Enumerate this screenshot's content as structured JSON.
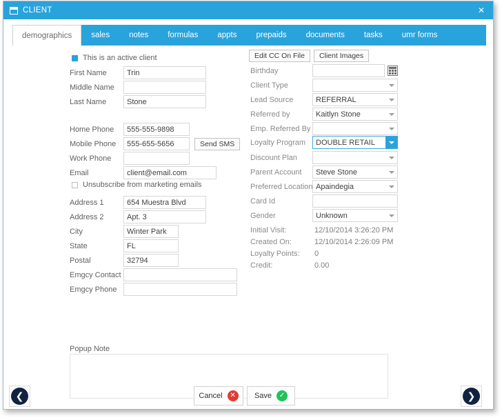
{
  "window": {
    "title": "CLIENT",
    "title_icon": "window-icon",
    "close_label": "✕"
  },
  "tabs": [
    {
      "label": "demographics",
      "active": true
    },
    {
      "label": "sales",
      "active": false
    },
    {
      "label": "notes",
      "active": false
    },
    {
      "label": "formulas",
      "active": false
    },
    {
      "label": "appts",
      "active": false
    },
    {
      "label": "prepaids",
      "active": false
    },
    {
      "label": "documents",
      "active": false
    },
    {
      "label": "tasks",
      "active": false
    },
    {
      "label": "umr forms",
      "active": false
    }
  ],
  "left": {
    "active_client_checkbox": {
      "label": "This is an active client",
      "checked": true
    },
    "first_name": {
      "label": "First Name",
      "value": "Trin"
    },
    "middle_name": {
      "label": "Middle Name",
      "value": ""
    },
    "last_name": {
      "label": "Last Name",
      "value": "Stone"
    },
    "home_phone": {
      "label": "Home Phone",
      "value": "555-555-9898"
    },
    "mobile_phone": {
      "label": "Mobile Phone",
      "value": "555-655-5656"
    },
    "send_sms_label": "Send SMS",
    "work_phone": {
      "label": "Work Phone",
      "value": ""
    },
    "email": {
      "label": "Email",
      "value": "client@email.com"
    },
    "unsubscribe_checkbox": {
      "label": "Unsubscribe from marketing emails",
      "checked": false
    },
    "address1": {
      "label": "Address 1",
      "value": "654 Muestra Blvd"
    },
    "address2": {
      "label": "Address 2",
      "value": "Apt. 3"
    },
    "city": {
      "label": "City",
      "value": "Winter Park"
    },
    "state": {
      "label": "State",
      "value": "FL"
    },
    "postal": {
      "label": "Postal",
      "value": "32794"
    },
    "emgcy_contact": {
      "label": "Emgcy Contact",
      "value": ""
    },
    "emgcy_phone": {
      "label": "Emgcy Phone",
      "value": ""
    },
    "popup_note": {
      "label": "Popup Note",
      "value": ""
    }
  },
  "right": {
    "edit_cc_label": "Edit CC On File",
    "client_images_label": "Client Images",
    "birthday": {
      "label": "Birthday",
      "value": ""
    },
    "client_type": {
      "label": "Client Type",
      "value": ""
    },
    "lead_source": {
      "label": "Lead Source",
      "value": "REFERRAL"
    },
    "referred_by": {
      "label": "Referred by",
      "value": "Kaitlyn Stone"
    },
    "emp_referred_by": {
      "label": "Emp. Referred By",
      "value": ""
    },
    "loyalty_program": {
      "label": "Loyalty Program",
      "value": "DOUBLE RETAIL",
      "focused": true
    },
    "discount_plan": {
      "label": "Discount Plan",
      "value": ""
    },
    "parent_account": {
      "label": "Parent Account",
      "value": "Steve Stone"
    },
    "preferred_location": {
      "label": "Preferred Location",
      "value": "Apaindegia"
    },
    "card_id": {
      "label": "Card Id",
      "value": ""
    },
    "gender": {
      "label": "Gender",
      "value": "Unknown"
    },
    "initial_visit": {
      "label": "Initial Visit:",
      "value": "12/10/2014 3:26:20 PM"
    },
    "created_on": {
      "label": "Created On:",
      "value": "12/10/2014 2:26:09 PM"
    },
    "loyalty_points": {
      "label": "Loyalty Points:",
      "value": "0"
    },
    "credit": {
      "label": "Credit:",
      "value": "0.00"
    }
  },
  "footer": {
    "prev_label": "❮",
    "next_label": "❯",
    "cancel_label": "Cancel",
    "cancel_badge": "✕",
    "save_label": "Save",
    "save_badge": "✓"
  },
  "colors": {
    "accent": "#29a3dc",
    "cancel": "#e23b35",
    "save": "#22c35a",
    "nav": "#102240"
  }
}
